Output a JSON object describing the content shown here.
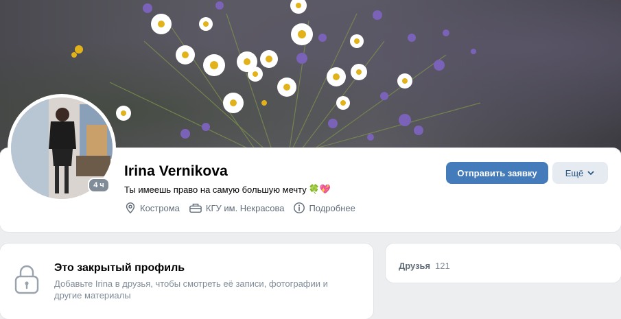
{
  "profile": {
    "name": "Irina Vernikova",
    "status_text": "Ты имеешь право на самую большую мечту",
    "status_emoji": "🍀💖",
    "online": "4 ч",
    "city": "Кострома",
    "university": "КГУ им. Некрасова",
    "more_info": "Подробнее"
  },
  "actions": {
    "send_request": "Отправить заявку",
    "more": "Ещё"
  },
  "closed_profile": {
    "title": "Это закрытый профиль",
    "description": "Добавьте Irina в друзья, чтобы смотреть её записи, фотографии и другие материалы"
  },
  "friends": {
    "label": "Друзья",
    "count": "121"
  },
  "colors": {
    "primary_button": "#447bba",
    "secondary_button": "#e5ebf1",
    "link": "#2a5885",
    "muted_text": "#626d7a",
    "background": "#edeef0"
  },
  "icons": [
    "location-icon",
    "building-icon",
    "info-icon",
    "lock-icon",
    "chevron-down-icon"
  ]
}
